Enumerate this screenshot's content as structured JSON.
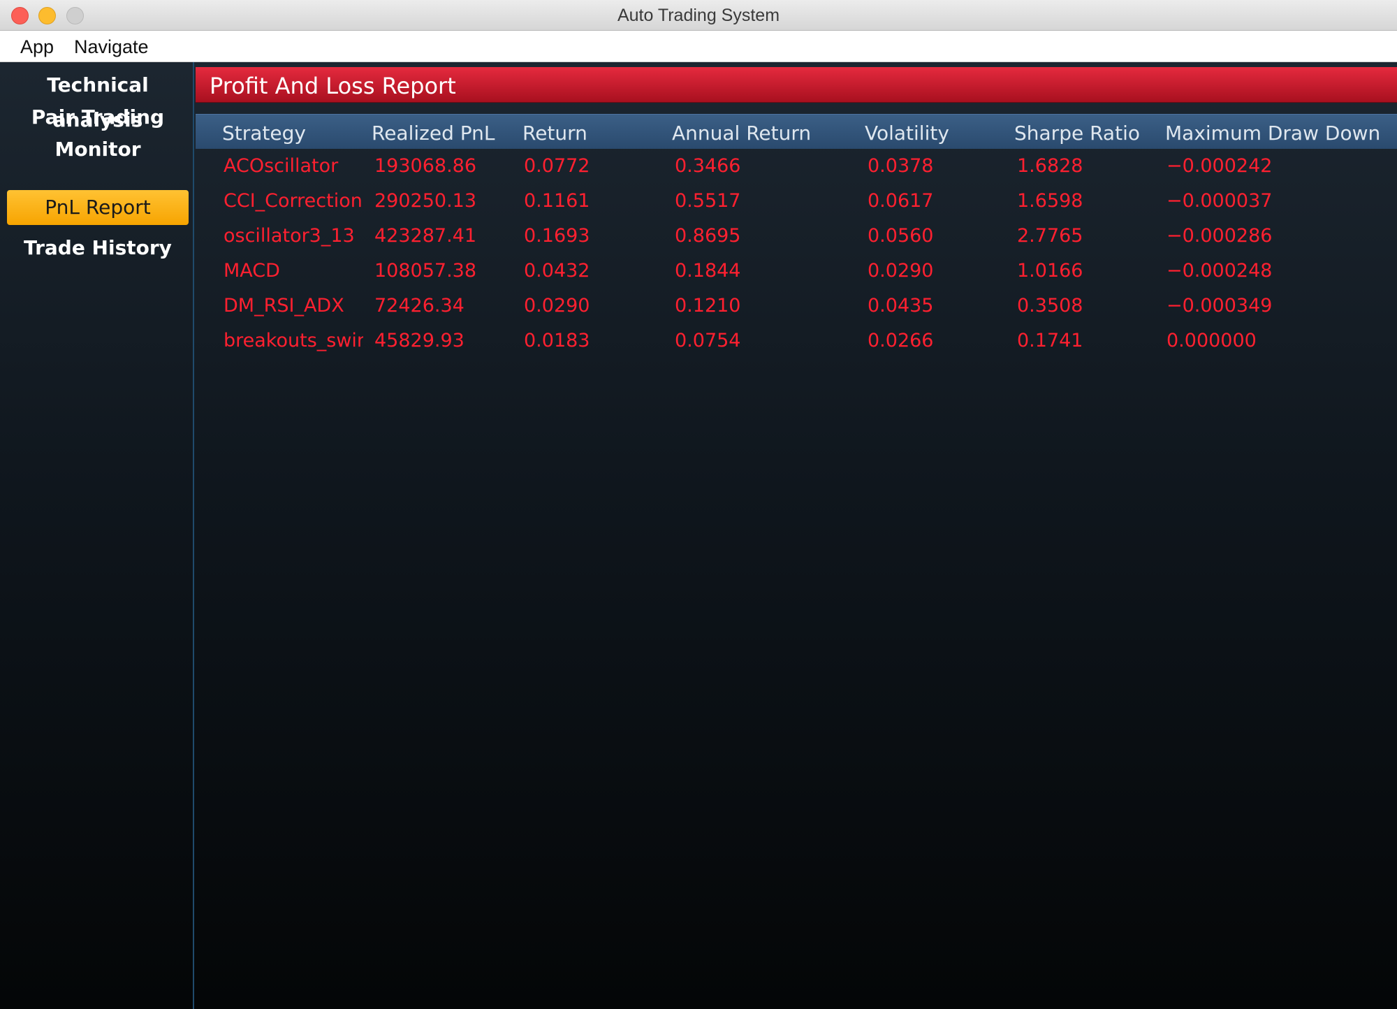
{
  "window": {
    "title": "Auto Trading System"
  },
  "menu": {
    "items": [
      "App",
      "Navigate"
    ]
  },
  "sidebar": {
    "items": [
      {
        "label": "Technical analysis",
        "active": false
      },
      {
        "label": "Pair Trading",
        "active": false
      },
      {
        "label": "Monitor",
        "active": false
      },
      {
        "label": "PnL Report",
        "active": true
      },
      {
        "label": "Trade History",
        "active": false
      }
    ]
  },
  "report": {
    "title": "Profit And Loss Report",
    "columns": [
      "Strategy",
      "Realized PnL",
      "Return",
      "Annual Return",
      "Volatility",
      "Sharpe Ratio",
      "Maximum Draw Down"
    ],
    "rows": [
      [
        "ACOscillator",
        "193068.86",
        "0.0772",
        "0.3466",
        "0.0378",
        "1.6828",
        "−0.000242"
      ],
      [
        "CCI_Correction",
        "290250.13",
        "0.1161",
        "0.5517",
        "0.0617",
        "1.6598",
        "−0.000037"
      ],
      [
        "oscillator3_13",
        "423287.41",
        "0.1693",
        "0.8695",
        "0.0560",
        "2.7765",
        "−0.000286"
      ],
      [
        "MACD",
        "108057.38",
        "0.0432",
        "0.1844",
        "0.0290",
        "1.0166",
        "−0.000248"
      ],
      [
        "DM_RSI_ADX",
        "72426.34",
        "0.0290",
        "0.1210",
        "0.0435",
        "0.3508",
        "−0.000349"
      ],
      [
        "breakouts_swing",
        "45829.93",
        "0.0183",
        "0.0754",
        "0.0266",
        "0.1741",
        "0.000000"
      ]
    ]
  },
  "colors": {
    "accent_red": "#e52a3e",
    "active_nav": "#ffc233",
    "table_header": "#3b5f86",
    "value_text": "#ff2030"
  }
}
